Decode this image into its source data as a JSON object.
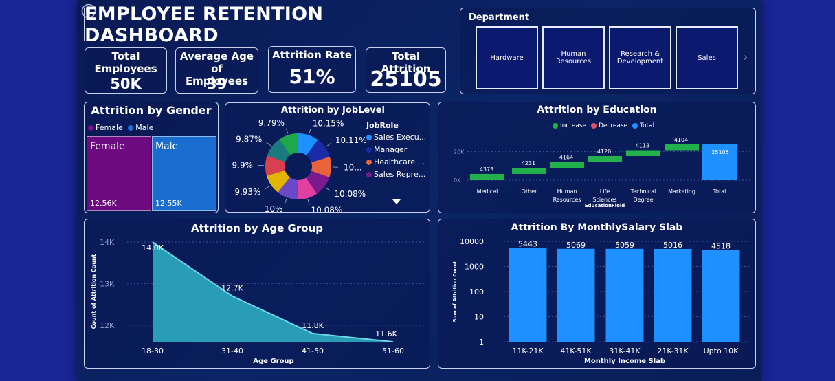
{
  "dashboard": {
    "title": "EMPLOYEE RETENTION DASHBOARD"
  },
  "kpis": [
    {
      "label_line1": "Total",
      "label_line2": "Employees",
      "value": "50K"
    },
    {
      "label_line1": "Average Age of",
      "label_line2": "Employees",
      "value": "39"
    },
    {
      "label_line1": "Attrition Rate",
      "label_line2": "",
      "value": "51%"
    },
    {
      "label_line1": "Total Attrition",
      "label_line2": "",
      "value": "25105"
    }
  ],
  "department": {
    "title": "Department",
    "tiles": [
      {
        "line1": "Hardware",
        "line2": ""
      },
      {
        "line1": "Human",
        "line2": "Resources"
      },
      {
        "line1": "Research &",
        "line2": "Development"
      },
      {
        "line1": "Sales",
        "line2": ""
      }
    ],
    "colors": {
      "tile_bg": "#0b1a6e",
      "tile_border": "#e6ebff"
    }
  },
  "gender": {
    "title": "Attrition by Gender",
    "legend": [
      {
        "label": "Female",
        "color": "#7a0e8c"
      },
      {
        "label": "Male",
        "color": "#1e6fd0"
      }
    ],
    "segments": [
      {
        "label": "Female",
        "value_label": "12.56K",
        "value": 12560,
        "color": "#6e0a80"
      },
      {
        "label": "Male",
        "value_label": "12.55K",
        "value": 12550,
        "color": "#1a6ccf"
      }
    ]
  },
  "joblevel": {
    "title": "Attrition by JobLevel",
    "legend_title": "JobRole",
    "legend": [
      {
        "label": "Sales Execu...",
        "color": "#1e90ff"
      },
      {
        "label": "Manager",
        "color": "#1a2aa8"
      },
      {
        "label": "Healthcare ...",
        "color": "#e8623a"
      },
      {
        "label": "Sales Repre...",
        "color": "#7a1a8c"
      }
    ],
    "slices": [
      {
        "label": "10.15%",
        "value": 10.15,
        "color": "#1e90ff"
      },
      {
        "label": "10.11%",
        "value": 10.11,
        "color": "#1a2aa8"
      },
      {
        "label": "10...",
        "value": 10.1,
        "color": "#e8623a"
      },
      {
        "label": "10.08%",
        "value": 10.08,
        "color": "#7a1a8c"
      },
      {
        "label": "10.08%",
        "value": 10.08,
        "color": "#e040a0"
      },
      {
        "label": "10%",
        "value": 10.0,
        "color": "#6a48c8"
      },
      {
        "label": "9.93%",
        "value": 9.93,
        "color": "#e2b300"
      },
      {
        "label": "9.9%",
        "value": 9.9,
        "color": "#d84050"
      },
      {
        "label": "9.87%",
        "value": 9.87,
        "color": "#1a7a80"
      },
      {
        "label": "9.79%",
        "value": 9.79,
        "color": "#1fa84a"
      }
    ],
    "scroll_icon": "chevron-down-icon"
  },
  "education": {
    "title": "Attrition by Education",
    "legend": [
      {
        "label": "Increase",
        "color": "#22b14c"
      },
      {
        "label": "Decrease",
        "color": "#e05060"
      },
      {
        "label": "Total",
        "color": "#1e90ff"
      }
    ],
    "y_ticks": [
      "20K",
      "0K"
    ],
    "x_axis_title": "EducationField"
  },
  "age": {
    "title": "Attrition by Age Group"
  },
  "salary": {
    "title": "Attrition By MonthlySalary Slab"
  },
  "chart_data": [
    {
      "type": "waterfall",
      "title": "Attrition by Education",
      "categories": [
        "Medical",
        "Other",
        "Human Resources",
        "Life Sciences",
        "Technical Degree",
        "Marketing",
        "Total"
      ],
      "values": [
        4373,
        4231,
        4164,
        4120,
        4113,
        4104,
        25105
      ],
      "value_labels": [
        "4373",
        "4231",
        "4164",
        "4120",
        "4113",
        "4104",
        "25105"
      ],
      "xlabel": "EducationField",
      "ylim": [
        0,
        25105
      ]
    },
    {
      "type": "area",
      "title": "Attrition by Age Group",
      "categories": [
        "18-30",
        "31-40",
        "41-50",
        "51-60"
      ],
      "values": [
        14000,
        12700,
        11800,
        11600
      ],
      "value_labels": [
        "14.0K",
        "12.7K",
        "11.8K",
        "11.6K"
      ],
      "y_ticks": [
        "12K",
        "13K",
        "14K"
      ],
      "xlabel": "Age Group",
      "ylabel": "Count of Attrition Count",
      "ylim": [
        11600,
        14000
      ],
      "color": "#2fb3c8"
    },
    {
      "type": "bar",
      "title": "Attrition By MonthlySalary Slab",
      "categories": [
        "11K-21K",
        "41K-51K",
        "31K-41K",
        "21K-31K",
        "Upto 10K"
      ],
      "values": [
        5443,
        5069,
        5059,
        5016,
        4518
      ],
      "y_ticks": [
        "1",
        "10",
        "100",
        "1000",
        "10000"
      ],
      "yscale": "log",
      "xlabel": "Monthly Income Slab",
      "ylabel": "Sum of Attrition Count",
      "ylim": [
        1,
        10000
      ],
      "color": "#1e90ff"
    }
  ]
}
